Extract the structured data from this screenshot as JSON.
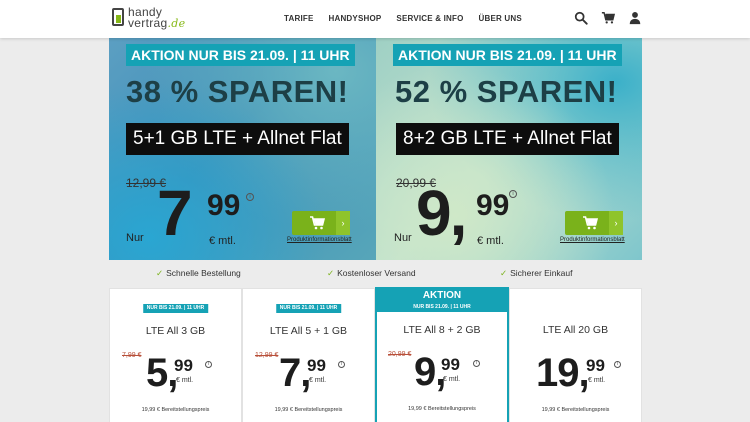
{
  "header": {
    "logo": {
      "top": "handy",
      "bottom": "vertrag",
      "suffix": ".de"
    },
    "nav": [
      "TARIFE",
      "HANDYSHOP",
      "SERVICE & INFO",
      "ÜBER UNS"
    ],
    "icons": [
      "search-icon",
      "cart-icon",
      "user-icon"
    ]
  },
  "banners": [
    {
      "aktion": "AKTION NUR BIS 21.09. | 11 UHR",
      "headline": "38 % SPAREN!",
      "tarif": "5+1 GB LTE + Allnet Flat",
      "old_price": "12,99 €",
      "nur": "Nur",
      "price_int": "7",
      "price_dec": "99",
      "unit": "€ mtl.",
      "info": "i",
      "arrow": "›",
      "link": "Produktinformationsblatt"
    },
    {
      "aktion": "AKTION NUR BIS 21.09. | 11 UHR",
      "headline": "52 % SPAREN!",
      "tarif": "8+2 GB LTE + Allnet Flat",
      "old_price": "20,99 €",
      "nur": "Nur",
      "price_int": "9,",
      "price_dec": "99",
      "unit": "€ mtl.",
      "info": "i",
      "arrow": "›",
      "link": "Produktinformationsblatt"
    }
  ],
  "features": [
    "Schnelle Bestellung",
    "Kostenloser Versand",
    "Sicherer Einkauf"
  ],
  "check": "✓",
  "cards": [
    {
      "badge": "NUR BIS 21.09. | 11 UHR",
      "title": "LTE All 3 GB",
      "old": "7,99 €",
      "int": "5,",
      "dec": "99",
      "unit": "€ mtl.",
      "info": "i",
      "fee": "19,99 € Bereitstellungspreis"
    },
    {
      "badge": "NUR BIS 21.09. | 11 UHR",
      "title": "LTE All 5 + 1 GB",
      "old": "12,99 €",
      "int": "7,",
      "dec": "99",
      "unit": "€ mtl.",
      "info": "i",
      "fee": "19,99 € Bereitstellungspreis"
    },
    {
      "top": "AKTION",
      "badge": "NUR BIS 21.09. | 11 UHR",
      "title": "LTE All 8 + 2 GB",
      "old": "20,99 €",
      "int": "9,",
      "dec": "99",
      "unit": "€ mtl.",
      "info": "i",
      "fee": "19,99 € Bereitstellungspreis"
    },
    {
      "title": "LTE All 20 GB",
      "int": "19,",
      "dec": "99",
      "unit": "€ mtl.",
      "info": "i",
      "fee": "19,99 € Bereitstellungspreis"
    }
  ],
  "colors": {
    "accent": "#15a2b5",
    "green": "#7ab21b",
    "old_price_red": "#b8503a"
  }
}
